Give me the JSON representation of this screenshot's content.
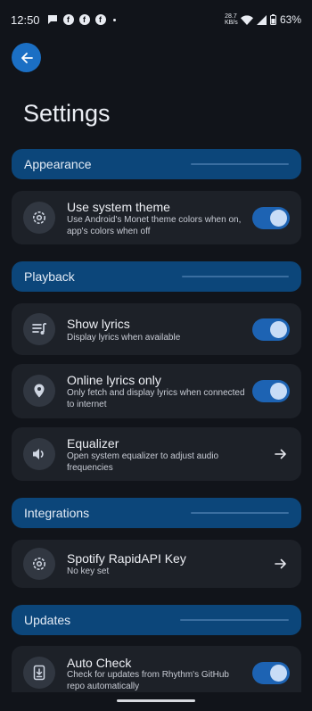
{
  "status_bar": {
    "time": "12:50",
    "net_speed_value": "28.7",
    "net_speed_unit": "KB/s",
    "battery": "63%"
  },
  "page": {
    "title": "Settings"
  },
  "sections": {
    "appearance": "Appearance",
    "playback": "Playback",
    "integrations": "Integrations",
    "updates": "Updates"
  },
  "items": {
    "system_theme": {
      "title": "Use system theme",
      "subtitle": "Use Android's Monet theme colors when on, app's colors when off",
      "enabled": true
    },
    "show_lyrics": {
      "title": "Show lyrics",
      "subtitle": "Display lyrics when available",
      "enabled": true
    },
    "online_lyrics": {
      "title": "Online lyrics only",
      "subtitle": "Only fetch and display lyrics when connected to internet",
      "enabled": true
    },
    "equalizer": {
      "title": "Equalizer",
      "subtitle": "Open system equalizer to adjust audio frequencies"
    },
    "spotify_key": {
      "title": "Spotify RapidAPI Key",
      "subtitle": "No key set"
    },
    "auto_check": {
      "title": "Auto Check",
      "subtitle": "Check for updates from Rhythm's GitHub repo automatically",
      "enabled": true
    }
  },
  "colors": {
    "background": "#11141a",
    "section_header": "#0c467a",
    "card": "#1d2128",
    "accent": "#1d63b3"
  }
}
